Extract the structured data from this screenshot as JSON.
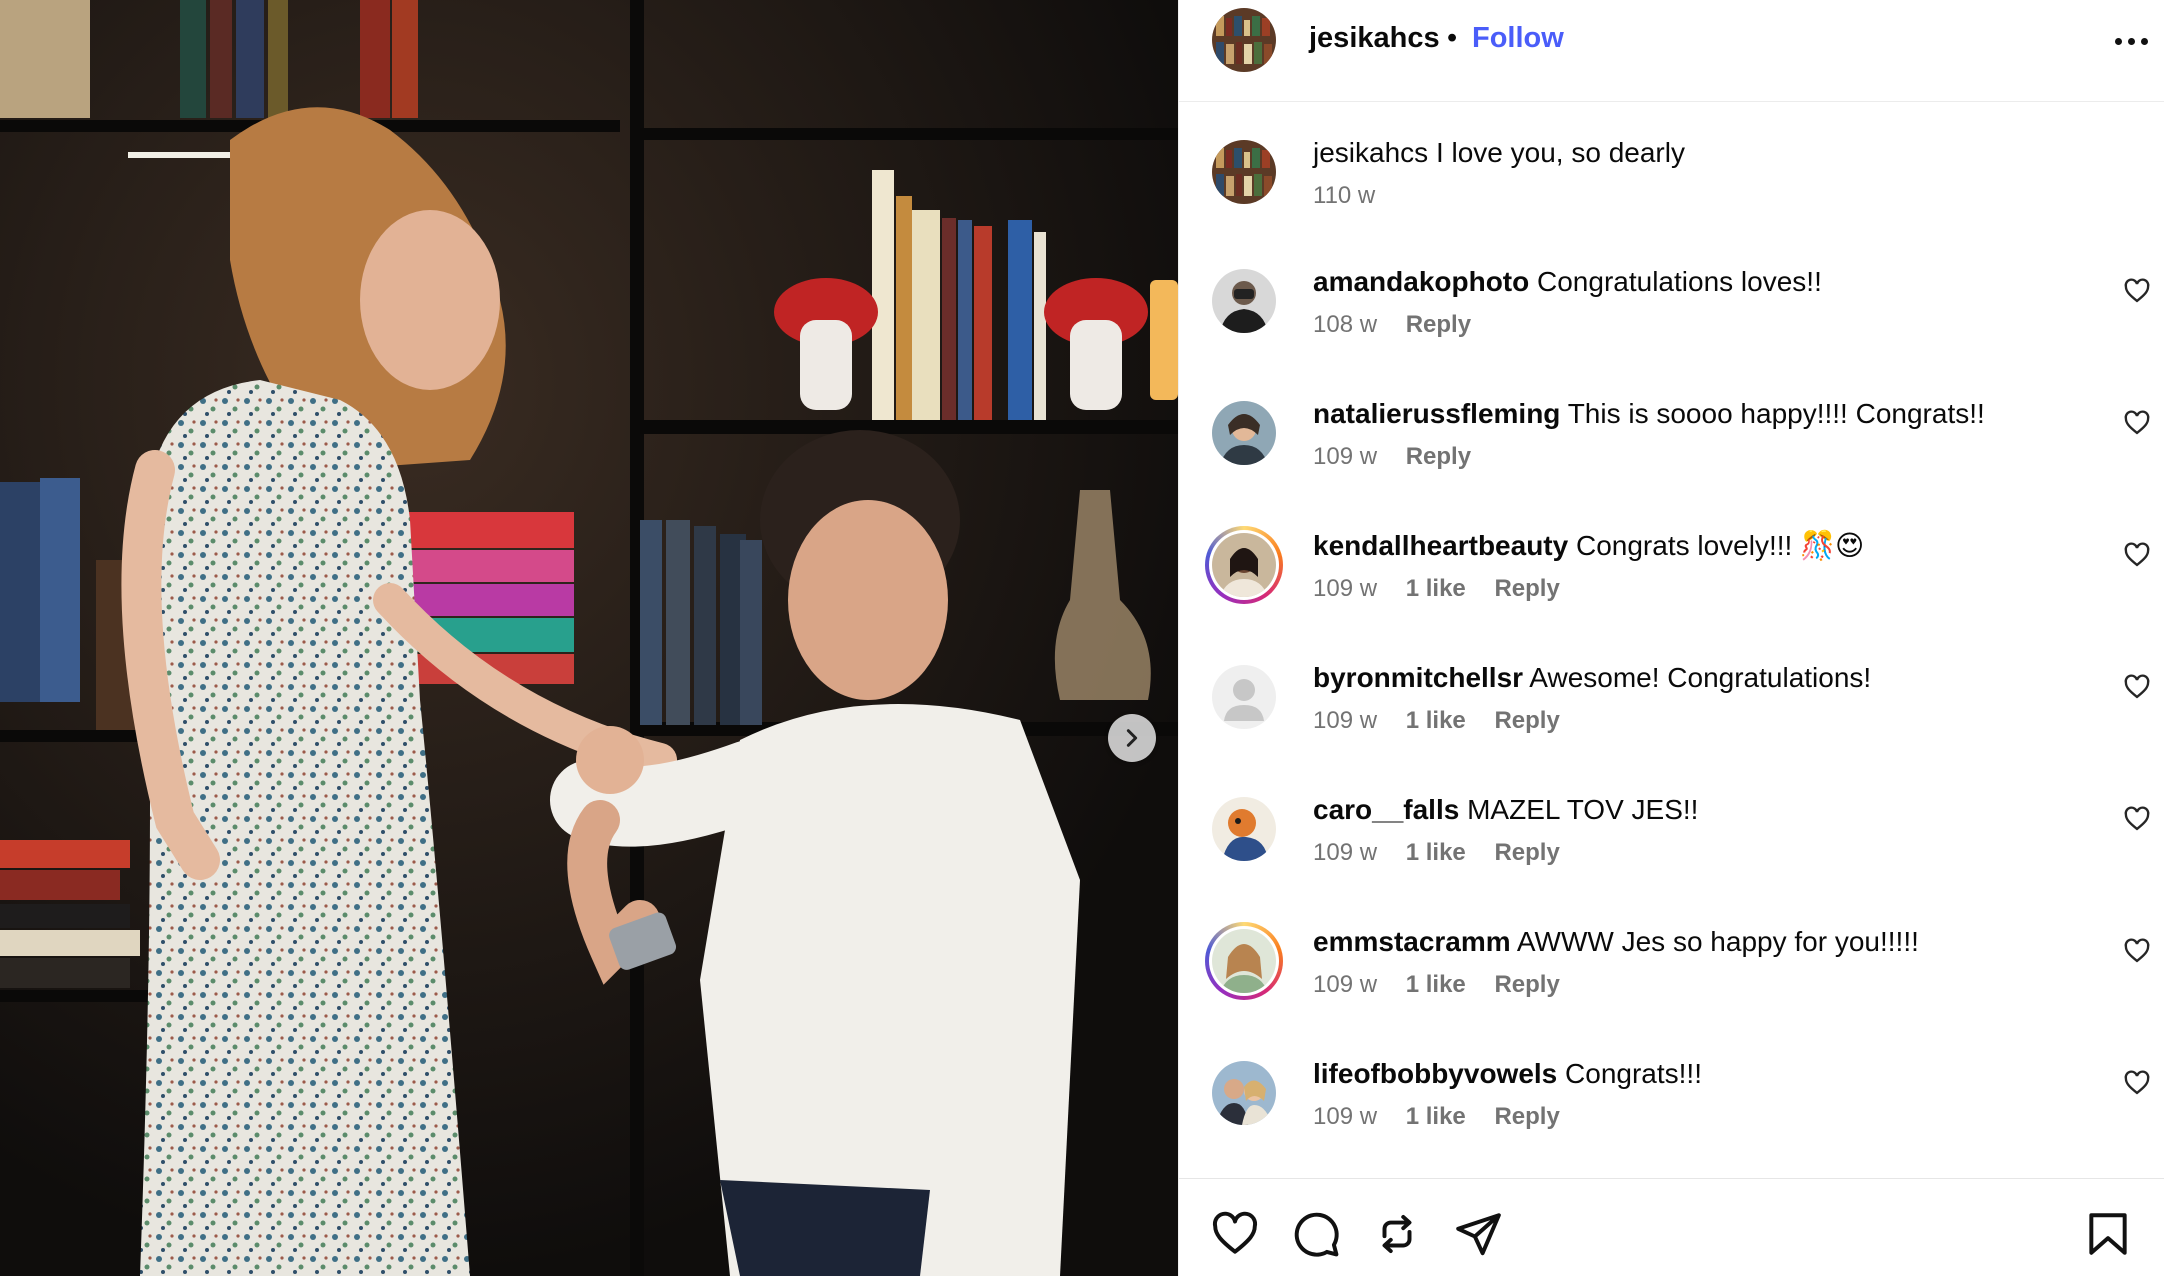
{
  "post": {
    "author": "jesikahcs",
    "follow_label": "Follow",
    "separator": "•",
    "caption_user": "jesikahcs",
    "caption_text": "I love you, so dearly",
    "caption_time": "110 w"
  },
  "comments": [
    {
      "user": "amandakophoto",
      "text": "Congratulations loves!!",
      "time": "108 w",
      "likes": "",
      "reply": "Reply",
      "avatar_ring": false
    },
    {
      "user": "natalierussfleming",
      "text": "This is soooo happy!!!! Congrats!!",
      "time": "109 w",
      "likes": "",
      "reply": "Reply",
      "avatar_ring": false
    },
    {
      "user": "kendallheartbeauty",
      "text": "Congrats lovely!!! 🎊😍",
      "time": "109 w",
      "likes": "1 like",
      "reply": "Reply",
      "avatar_ring": true
    },
    {
      "user": "byronmitchellsr",
      "text": "Awesome! Congratulations!",
      "time": "109 w",
      "likes": "1 like",
      "reply": "Reply",
      "avatar_ring": false
    },
    {
      "user": "caro__falls",
      "text": "MAZEL TOV JES!!",
      "time": "109 w",
      "likes": "1 like",
      "reply": "Reply",
      "avatar_ring": false
    },
    {
      "user": "emmstacramm",
      "text": "AWWW Jes so happy for you!!!!!",
      "time": "109 w",
      "likes": "1 like",
      "reply": "Reply",
      "avatar_ring": true
    },
    {
      "user": "lifeofbobbyvowels",
      "text": "Congrats!!!",
      "time": "109 w",
      "likes": "1 like",
      "reply": "Reply",
      "avatar_ring": false
    }
  ],
  "icons": {
    "more": "more-options-icon",
    "next": "chevron-right-icon",
    "like": "heart-icon",
    "comment": "comment-bubble-icon",
    "repost": "repost-icon",
    "share": "paper-plane-icon",
    "save": "bookmark-icon"
  },
  "colors": {
    "follow": "#4a5df9",
    "meta": "#737373",
    "story_ring": [
      "#feda75",
      "#fa7e1e",
      "#d62976",
      "#962fbf",
      "#4f5bd5"
    ]
  }
}
